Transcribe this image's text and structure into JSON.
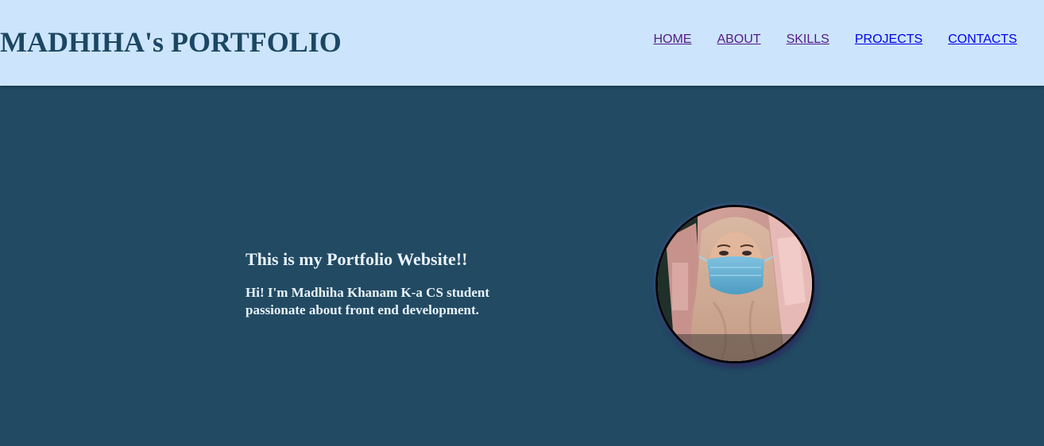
{
  "header": {
    "title": "MADHIHA's PORTFOLIO",
    "nav": [
      {
        "label": "HOME"
      },
      {
        "label": "ABOUT"
      },
      {
        "label": "SKILLS"
      },
      {
        "label": "PROJECTS"
      },
      {
        "label": "CONTACTS"
      }
    ]
  },
  "hero": {
    "heading": "This is my Portfolio Website!!",
    "intro": "Hi! I'm Madhiha Khanam K-a CS student passionate about front end development."
  },
  "colors": {
    "header_bg": "#cce5fc",
    "title": "#1c4763",
    "hero_bg": "#224a63",
    "hero_text": "#e9f3fb",
    "link_visited": "#551a8b",
    "link_unvisited": "#0000ee"
  }
}
